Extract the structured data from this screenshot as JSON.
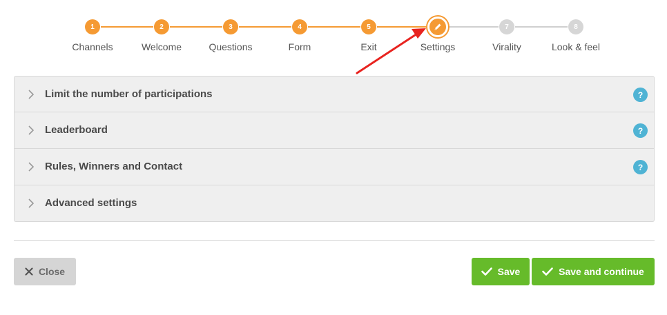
{
  "stepper": {
    "steps": [
      {
        "number": "1",
        "label": "Channels",
        "state": "done"
      },
      {
        "number": "2",
        "label": "Welcome",
        "state": "done"
      },
      {
        "number": "3",
        "label": "Questions",
        "state": "done"
      },
      {
        "number": "4",
        "label": "Form",
        "state": "done"
      },
      {
        "number": "5",
        "label": "Exit",
        "state": "done"
      },
      {
        "number": "",
        "label": "Settings",
        "state": "current",
        "icon": "pencil-icon"
      },
      {
        "number": "7",
        "label": "Virality",
        "state": "todo"
      },
      {
        "number": "8",
        "label": "Look & feel",
        "state": "todo"
      }
    ]
  },
  "accordion": {
    "items": [
      {
        "label": "Limit the number of participations",
        "help": "?"
      },
      {
        "label": "Leaderboard",
        "help": "?"
      },
      {
        "label": "Rules, Winners and Contact",
        "help": "?"
      },
      {
        "label": "Advanced settings"
      }
    ]
  },
  "footer": {
    "close_label": "Close",
    "save_label": "Save",
    "save_continue_label": "Save and continue"
  },
  "colors": {
    "accent": "#f59a33",
    "success": "#66bb2a",
    "help": "#4fb3d4",
    "annotation_arrow": "#e8231f"
  }
}
